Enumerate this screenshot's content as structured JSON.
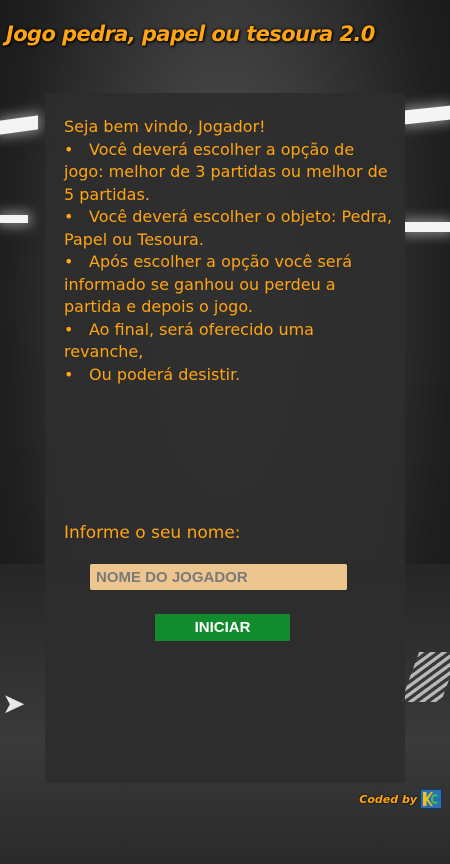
{
  "page": {
    "title": "Jogo pedra, papel ou tesoura 2.0"
  },
  "intro": {
    "greeting": "Seja bem vindo, Jogador!",
    "rules": [
      "Você deverá escolher a opção de jogo: melhor de 3 partidas ou melhor de 5 partidas.",
      "Você deverá escolher o objeto: Pedra, Papel ou Tesoura.",
      "Após escolher a opção você será informado se ganhou ou perdeu a partida e depois o jogo.",
      "Ao final, será oferecido uma revanche,",
      "Ou poderá desistir."
    ]
  },
  "form": {
    "name_label": "Informe o seu nome:",
    "name_placeholder": "NOME DO JOGADOR",
    "name_value": "",
    "start_label": "INICIAR"
  },
  "footer": {
    "credit": "Coded by",
    "logo_icon": "kg-logo-icon"
  },
  "colors": {
    "accent": "#ffa412",
    "input_bg": "#ecc68e",
    "button_bg": "#128a2e",
    "panel_bg": "#2d2d2d"
  }
}
